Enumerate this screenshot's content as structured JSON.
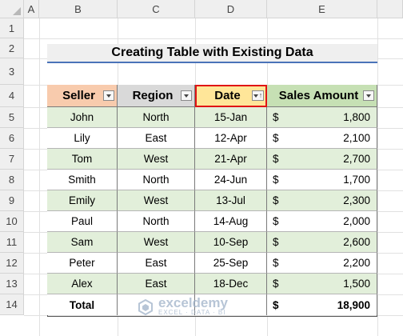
{
  "columns": [
    "A",
    "B",
    "C",
    "D",
    "E"
  ],
  "rows": [
    "1",
    "2",
    "3",
    "4",
    "5",
    "6",
    "7",
    "8",
    "9",
    "10",
    "11",
    "12",
    "13",
    "14"
  ],
  "title": "Creating Table with Existing Data",
  "headers": {
    "seller": "Seller",
    "region": "Region",
    "date": "Date",
    "amount": "Sales Amount"
  },
  "records": [
    {
      "seller": "John",
      "region": "North",
      "date": "15-Jan",
      "currency": "$",
      "amount": "1,800"
    },
    {
      "seller": "Lily",
      "region": "East",
      "date": "12-Apr",
      "currency": "$",
      "amount": "2,100"
    },
    {
      "seller": "Tom",
      "region": "West",
      "date": "21-Apr",
      "currency": "$",
      "amount": "2,700"
    },
    {
      "seller": "Smith",
      "region": "North",
      "date": "24-Jun",
      "currency": "$",
      "amount": "1,700"
    },
    {
      "seller": "Emily",
      "region": "West",
      "date": "13-Jul",
      "currency": "$",
      "amount": "2,300"
    },
    {
      "seller": "Paul",
      "region": "North",
      "date": "14-Aug",
      "currency": "$",
      "amount": "2,000"
    },
    {
      "seller": "Sam",
      "region": "West",
      "date": "10-Sep",
      "currency": "$",
      "amount": "2,600"
    },
    {
      "seller": "Peter",
      "region": "East",
      "date": "25-Sep",
      "currency": "$",
      "amount": "2,200"
    },
    {
      "seller": "Alex",
      "region": "East",
      "date": "18-Dec",
      "currency": "$",
      "amount": "1,500"
    }
  ],
  "total": {
    "label": "Total",
    "currency": "$",
    "amount": "18,900"
  },
  "watermark": {
    "name": "exceldemy",
    "sub": "EXCEL · DATA · BI"
  },
  "colors": {
    "seller_header": "#f8cbad",
    "region_header": "#d9d9d9",
    "date_header": "#ffe699",
    "amount_header": "#c6e0b4",
    "band": "#e2efda",
    "active_border": "#e01414"
  }
}
